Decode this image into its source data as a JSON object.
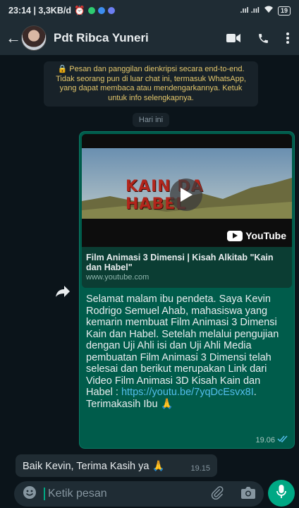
{
  "status_bar": {
    "left_text": "23:14 | 3,3KB/d",
    "right_text": ".ııl .ııl",
    "battery": "19"
  },
  "header": {
    "contact_name": "Pdt Ribca Yuneri",
    "icons": [
      "back-arrow-icon",
      "video-call-icon",
      "phone-icon",
      "more-vert-icon"
    ]
  },
  "chat": {
    "encryption_notice": "Pesan dan panggilan dienkripsi secara end-to-end. Tidak seorang pun di luar chat ini, termasuk WhatsApp, yang dapat membaca atau mendengarkannya. Ketuk untuk info selengkapnya.",
    "date_chip": "Hari ini",
    "outgoing": {
      "preview": {
        "thumbnail_text_left": "KAIN DA",
        "thumbnail_text_right": "HABEL",
        "brand": "YouTube",
        "title": "Film Animasi 3 Dimensi | Kisah Alkitab \"Kain dan Habel\"",
        "url": "www.youtube.com"
      },
      "text_before_link": "Selamat malam ibu pendeta. Saya Kevin Rodrigo Semuel Ahab, mahasiswa yang kemarin membuat Film Animasi 3 Dimensi Kain dan Habel. Setelah melalui pengujian dengan Uji Ahli isi dan Uji Ahli Media pembuatan Film Animasi 3 Dimensi telah selesai dan berikut merupakan Link dari Video Film Animasi 3D Kisah Kain dan Habel : ",
      "link": "https://youtu.be/7yqDcEsvx8I",
      "text_after_link": ". Terimakasih Ibu 🙏",
      "time": "19.06",
      "status": "read"
    },
    "incoming": {
      "text": "Baik Kevin, Terima Kasih ya 🙏",
      "time": "19.15"
    }
  },
  "input_bar": {
    "placeholder": "Ketik pesan",
    "icons": [
      "emoji-icon",
      "attach-icon",
      "camera-icon",
      "mic-icon"
    ]
  },
  "colors": {
    "header_bg": "#1f2c34",
    "chat_bg": "#0b141a",
    "outgoing_bubble": "#005c4b",
    "incoming_bubble": "#202c33",
    "accent": "#00a884",
    "link": "#53bdeb",
    "notice_text": "#e4c76b"
  }
}
